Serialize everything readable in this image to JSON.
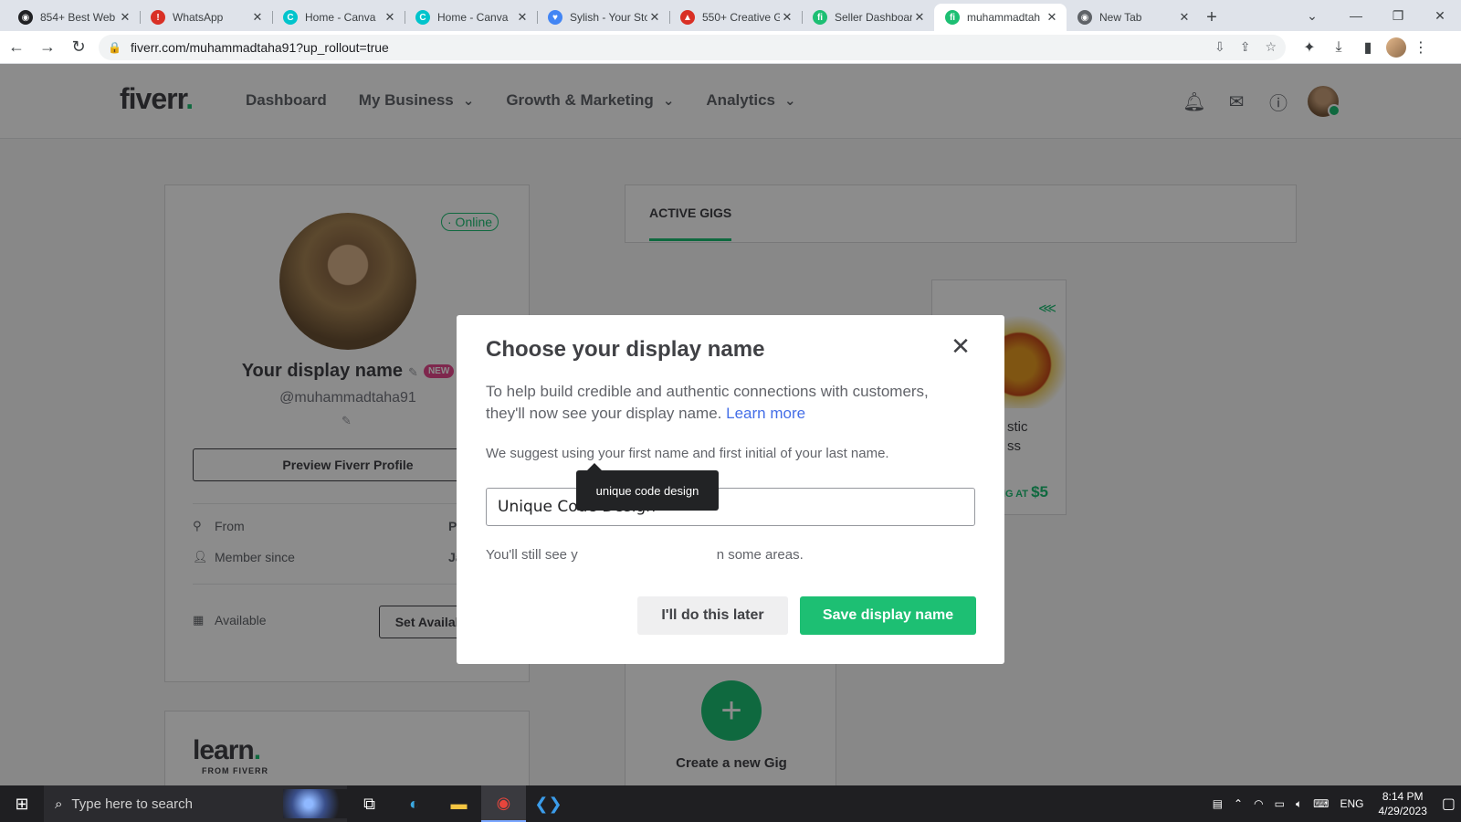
{
  "browser": {
    "tabs": [
      {
        "title": "854+ Best Web",
        "fav_color": "#202124",
        "fav_glyph": "◉",
        "active": false
      },
      {
        "title": "WhatsApp",
        "fav_color": "#d93025",
        "fav_glyph": "!",
        "active": false
      },
      {
        "title": "Home - Canva",
        "fav_color": "#00c4cc",
        "fav_glyph": "C",
        "active": false
      },
      {
        "title": "Home - Canva",
        "fav_color": "#00c4cc",
        "fav_glyph": "C",
        "active": false
      },
      {
        "title": "Sylish - Your Sto",
        "fav_color": "#4285f4",
        "fav_glyph": "♥",
        "active": false
      },
      {
        "title": "550+ Creative G",
        "fav_color": "#d93025",
        "fav_glyph": "▲",
        "active": false
      },
      {
        "title": "Seller Dashboar",
        "fav_color": "#1dbf73",
        "fav_glyph": "fi",
        "active": false
      },
      {
        "title": "muhammadtah",
        "fav_color": "#1dbf73",
        "fav_glyph": "fi",
        "active": true
      },
      {
        "title": "New Tab",
        "fav_color": "#5f6368",
        "fav_glyph": "◉",
        "active": false
      }
    ],
    "url": "fiverr.com/muhammadtaha91?up_rollout=true"
  },
  "header": {
    "logo": "fiverr",
    "nav": [
      "Dashboard",
      "My Business",
      "Growth & Marketing",
      "Analytics"
    ]
  },
  "profile": {
    "status": "· Online",
    "display_name": "Your display name",
    "new_badge": "NEW",
    "handle": "@muhammadtaha91",
    "preview_button": "Preview Fiverr Profile",
    "from_label": "From",
    "from_value": "P",
    "member_label": "Member since",
    "member_value": "Ja",
    "available_label": "Available",
    "availability_button": "Set Availability"
  },
  "learn": {
    "logo": "learn",
    "sub": "FROM FIVERR"
  },
  "gigs": {
    "tab": "ACTIVE GIGS",
    "card_title_line1": "stic",
    "card_title_line2": "ss",
    "card_price_prefix": "NG AT",
    "card_price": "$5",
    "create_label": "Create a new Gig"
  },
  "modal": {
    "title": "Choose your display name",
    "desc": "To help build credible and authentic connections with customers, they'll now see your display name.",
    "learn_more": "Learn more",
    "suggest": "We suggest using your first name and first initial of your last name.",
    "input_value": "Unique Code Design",
    "note_start": "You'll still see y",
    "note_end": "n some areas.",
    "tooltip": "unique code design",
    "later_button": "I'll do this later",
    "save_button": "Save display name"
  },
  "taskbar": {
    "search_placeholder": "Type here to search",
    "lang": "ENG",
    "time": "8:14 PM",
    "date": "4/29/2023"
  }
}
